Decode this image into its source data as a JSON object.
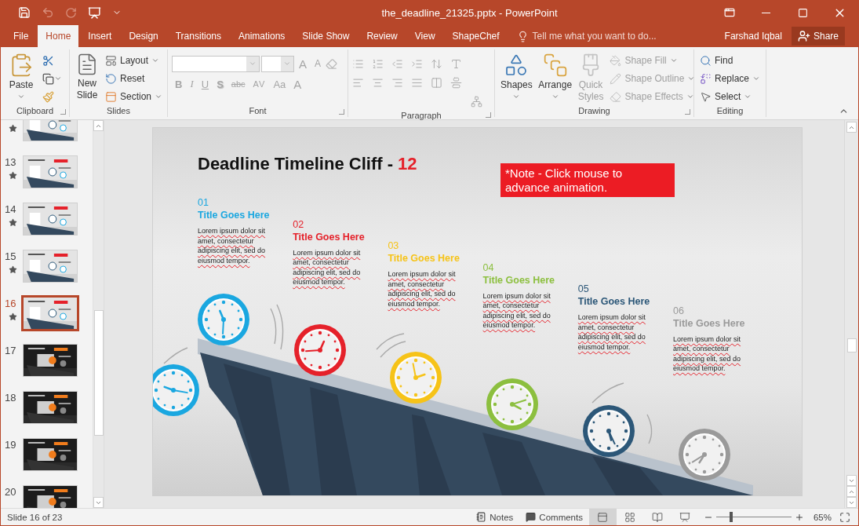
{
  "window": {
    "title": "the_deadline_21325.pptx - PowerPoint"
  },
  "tabs": [
    {
      "label": "File",
      "selected": false
    },
    {
      "label": "Home",
      "selected": true
    },
    {
      "label": "Insert",
      "selected": false
    },
    {
      "label": "Design",
      "selected": false
    },
    {
      "label": "Transitions",
      "selected": false
    },
    {
      "label": "Animations",
      "selected": false
    },
    {
      "label": "Slide Show",
      "selected": false
    },
    {
      "label": "Review",
      "selected": false
    },
    {
      "label": "View",
      "selected": false
    },
    {
      "label": "ShapeChef",
      "selected": false
    }
  ],
  "tell_me": {
    "placeholder": "Tell me what you want to do..."
  },
  "user": "Farshad Iqbal",
  "share": "Share",
  "ribbon": {
    "clipboard": {
      "label": "Clipboard",
      "paste": "Paste"
    },
    "slides": {
      "label": "Slides",
      "new_slide": "New Slide",
      "items": [
        {
          "label": "Layout",
          "kind": "layout",
          "dropdown": true
        },
        {
          "label": "Reset",
          "kind": "reset",
          "dropdown": false
        },
        {
          "label": "Section",
          "kind": "section",
          "dropdown": true
        }
      ]
    },
    "font": {
      "label": "Font",
      "disabled": true,
      "size_buttons": [
        {
          "label": "A",
          "kind": "grow"
        },
        {
          "label": "A",
          "kind": "shrink"
        }
      ],
      "format_buttons": [
        {
          "label": "B",
          "kind": "bold"
        },
        {
          "label": "I",
          "kind": "italic"
        },
        {
          "label": "U",
          "kind": "underline"
        },
        {
          "label": "S",
          "kind": "shadow"
        },
        {
          "label": "abc",
          "kind": "strike"
        },
        {
          "label": "AV",
          "kind": "spacing"
        },
        {
          "label": "Aa",
          "kind": "case"
        },
        {
          "label": "A",
          "kind": "color"
        }
      ]
    },
    "paragraph": {
      "label": "Paragraph",
      "disabled": true
    },
    "drawing": {
      "label": "Drawing",
      "big": [
        {
          "label": "Shapes",
          "kind": "shapes",
          "disabled": false
        },
        {
          "label": "Arrange",
          "kind": "arrange",
          "disabled": false
        },
        {
          "label": "Quick Styles",
          "kind": "styles",
          "disabled": true
        }
      ],
      "items": [
        {
          "label": "Shape Fill",
          "kind": "fill",
          "disabled": true
        },
        {
          "label": "Shape Outline",
          "kind": "outline",
          "disabled": true
        },
        {
          "label": "Shape Effects",
          "kind": "effects",
          "disabled": true
        }
      ]
    },
    "editing": {
      "label": "Editing",
      "items": [
        {
          "label": "Find",
          "kind": "find",
          "dropdown": false
        },
        {
          "label": "Replace",
          "kind": "replace",
          "dropdown": true
        },
        {
          "label": "Select",
          "kind": "select",
          "dropdown": true
        }
      ]
    }
  },
  "thumbnails": [
    {
      "kind": "light",
      "starred": true,
      "selected": false
    },
    {
      "number": "13",
      "kind": "light",
      "starred": true,
      "selected": false
    },
    {
      "number": "14",
      "kind": "light",
      "starred": true,
      "selected": false
    },
    {
      "number": "15",
      "kind": "light",
      "starred": true,
      "selected": false
    },
    {
      "number": "16",
      "kind": "light",
      "starred": true,
      "selected": true
    },
    {
      "number": "17",
      "kind": "dark",
      "starred": false,
      "selected": false
    },
    {
      "number": "18",
      "kind": "dark",
      "starred": false,
      "selected": false
    },
    {
      "number": "19",
      "kind": "dark",
      "starred": false,
      "selected": false
    },
    {
      "number": "20",
      "kind": "dark",
      "starred": false,
      "selected": false
    }
  ],
  "slide": {
    "title": "Deadline Timeline Cliff - ",
    "title_number": "12",
    "note": "*Note -  Click mouse to advance animation.",
    "items": [
      {
        "number": "01",
        "title": "Title Goes Here",
        "body": "Lorem ipsum dolor sit amet, consectetur adipiscing elit, sed do eiusmod tempor.",
        "color": "#1aa7e0"
      },
      {
        "number": "02",
        "title": "Title Goes Here",
        "body": "Lorem ipsum dolor sit amet, consectetur adipiscing elit, sed do eiusmod tempor.",
        "color": "#e5212a"
      },
      {
        "number": "03",
        "title": "Title Goes Here",
        "body": "Lorem ipsum dolor sit amet, consectetur adipiscing elit, sed do eiusmod tempor.",
        "color": "#f6c318"
      },
      {
        "number": "04",
        "title": "Title Goes Here",
        "body": "Lorem ipsum dolor sit amet, consectetur adipiscing elit, sed do eiusmod tempor.",
        "color": "#8cbf3f"
      },
      {
        "number": "05",
        "title": "Title Goes Here",
        "body": "Lorem ipsum dolor sit amet, consectetur adipiscing elit, sed do eiusmod tempor.",
        "color": "#2c5778"
      },
      {
        "number": "06",
        "title": "Title Goes Here",
        "body": "Lorem ipsum dolor sit amet, consectetur adipiscing elit, sed do eiusmod tempor.",
        "color": "#9a9a9a"
      }
    ]
  },
  "status_bar": {
    "slide_info": "Slide 16 of 23",
    "notes": "Notes",
    "comments": "Comments",
    "views": [
      {
        "kind": "normal",
        "selected": true
      },
      {
        "kind": "sorter",
        "selected": false
      },
      {
        "kind": "reading",
        "selected": false
      },
      {
        "kind": "slideshow",
        "selected": false
      }
    ],
    "zoom": {
      "level": 0.2,
      "reading": "65%"
    }
  }
}
